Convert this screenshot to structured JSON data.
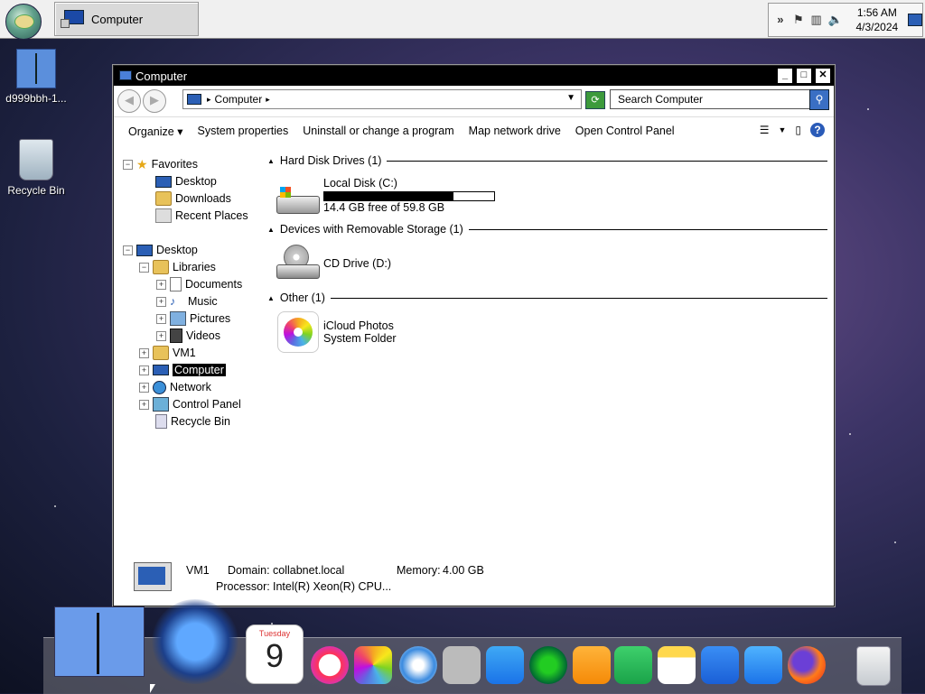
{
  "taskbar": {
    "task_title": "Computer",
    "clock_time": "1:56 AM",
    "clock_date": "4/3/2024",
    "tray_icons": [
      "chevron-icon",
      "flag-icon",
      "network-icon",
      "volume-muted-icon"
    ]
  },
  "desktop": {
    "icons": [
      {
        "label": "d999bbh-1...",
        "icon": "finder-icon"
      },
      {
        "label": "Recycle Bin",
        "icon": "recycle-bin-icon"
      }
    ]
  },
  "window": {
    "title": "Computer",
    "address_label": "Computer",
    "search_placeholder": "Search Computer",
    "toolbar": {
      "organize": "Organize",
      "system_properties": "System properties",
      "uninstall": "Uninstall or change a program",
      "map_drive": "Map network drive",
      "control_panel": "Open Control Panel"
    },
    "tree": {
      "favorites": "Favorites",
      "fav_desktop": "Desktop",
      "fav_downloads": "Downloads",
      "fav_recent": "Recent Places",
      "desktop": "Desktop",
      "libraries": "Libraries",
      "documents": "Documents",
      "music": "Music",
      "pictures": "Pictures",
      "videos": "Videos",
      "vm1": "VM1",
      "computer": "Computer",
      "network": "Network",
      "control_panel": "Control Panel",
      "recycle_bin": "Recycle Bin"
    },
    "groups": {
      "hdd": "Hard Disk Drives (1)",
      "removable": "Devices with Removable Storage (1)",
      "other": "Other (1)"
    },
    "items": {
      "local_disk_name": "Local Disk (C:)",
      "local_disk_free": "14.4 GB free of 59.8 GB",
      "local_disk_used_fraction": 0.76,
      "cd_drive": "CD Drive (D:)",
      "icloud_name": "iCloud Photos",
      "icloud_type": "System Folder"
    },
    "details": {
      "name": "VM1",
      "domain_label": "Domain:",
      "domain_value": "collabnet.local",
      "memory_label": "Memory:",
      "memory_value": "4.00 GB",
      "processor_label": "Processor:",
      "processor_value": "Intel(R) Xeon(R) CPU..."
    }
  },
  "dock": {
    "calendar_day": "Tuesday",
    "calendar_date": "9",
    "apps": [
      "finder-icon",
      "system-orb-icon",
      "calendar-icon",
      "music-icon",
      "photos-icon",
      "safari-icon",
      "contacts-icon",
      "icloud-icon",
      "radar-icon",
      "pages-icon",
      "numbers-icon",
      "notes-icon",
      "keynote-icon",
      "mail-icon",
      "firefox-icon",
      "trash-icon"
    ]
  }
}
